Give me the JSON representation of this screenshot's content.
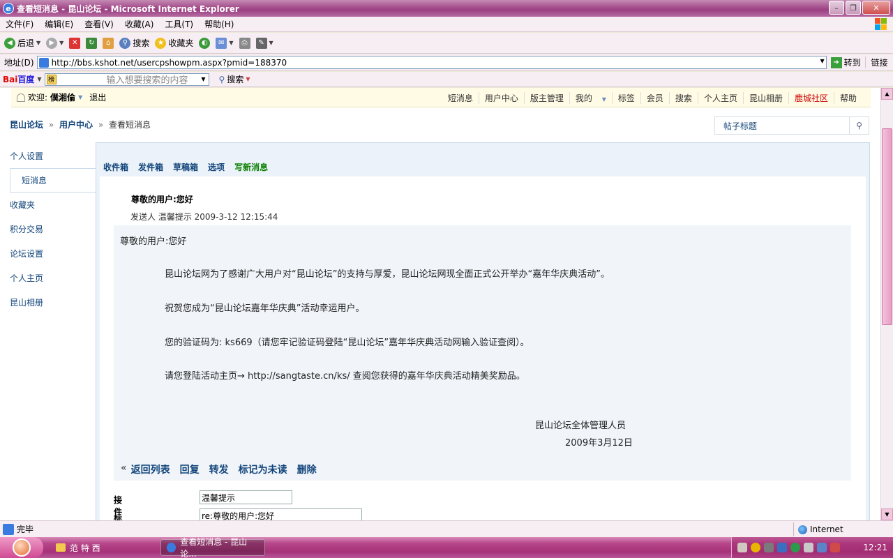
{
  "window": {
    "title": "查看短消息 - 昆山论坛 - Microsoft Internet Explorer",
    "ie_glyph": "e",
    "min": "–",
    "max": "❐",
    "close": "✕"
  },
  "menu": [
    "文件(F)",
    "编辑(E)",
    "查看(V)",
    "收藏(A)",
    "工具(T)",
    "帮助(H)"
  ],
  "toolbar": {
    "back": "后退",
    "search": "搜索",
    "favorites": "收藏夹"
  },
  "address": {
    "label": "地址(D)",
    "url": "http://bbs.kshot.net/usercpshowpm.aspx?pmid=188370",
    "go": "转到",
    "links": "链接"
  },
  "baidu": {
    "logo_a": "Bai",
    "logo_b": "百度",
    "placeholder": "输入想要搜索的内容",
    "search": "搜索",
    "mark": "榜"
  },
  "site": {
    "welcome_label": "欢迎:",
    "username": "僕湘倫",
    "logout": "退出",
    "nav": [
      "短消息",
      "用户中心",
      "版主管理",
      "我的",
      "标签",
      "会员",
      "搜索",
      "个人主页",
      "昆山相册",
      "鹿城社区",
      "帮助"
    ],
    "breadcrumb": {
      "home": "昆山论坛",
      "center": "用户中心",
      "current": "查看短消息",
      "sep": "»"
    },
    "post_search": "帖子标题",
    "sidebar": [
      "个人设置",
      "短消息",
      "收藏夹",
      "积分交易",
      "论坛设置",
      "个人主页",
      "昆山相册"
    ],
    "tabs": [
      "收件箱",
      "发件箱",
      "草稿箱",
      "选项",
      "写新消息"
    ]
  },
  "message": {
    "title": "尊敬的用户:您好",
    "meta": "发送人 温馨提示  2009-3-12 12:15:44",
    "greeting": "尊敬的用户:您好",
    "p1": "昆山论坛网为了感谢广大用户对“昆山论坛”的支持与厚爱，昆山论坛网现全面正式公开举办“嘉年华庆典活动”。",
    "p2": "祝贺您成为“昆山论坛嘉年华庆典”活动幸运用户。",
    "p3": "您的验证码为:   ks669（请您牢记验证码登陆“昆山论坛”嘉年华庆典活动网输入验证查阅）。",
    "p4": "请您登陆活动主页→ http://sangtaste.cn/ks/ 查阅您获得的嘉年华庆典活动精美奖励品。",
    "signature": "昆山论坛全体管理人员",
    "date": "2009年3月12日"
  },
  "actions": {
    "back_glyph": "«",
    "list": "返回列表",
    "reply": "回复",
    "forward": "转发",
    "mark_unread": "标记为未读",
    "delete": "删除"
  },
  "reply": {
    "to_label": "接件人:",
    "to_value": "温馨提示",
    "subject_label": "标题:",
    "subject_value": "re:尊敬的用户:您好"
  },
  "status": {
    "text": "完毕",
    "zone": "Internet"
  },
  "taskbar": {
    "task1": "范 特 西",
    "task2": "查看短消息 - 昆山论...",
    "clock": "12:21"
  }
}
